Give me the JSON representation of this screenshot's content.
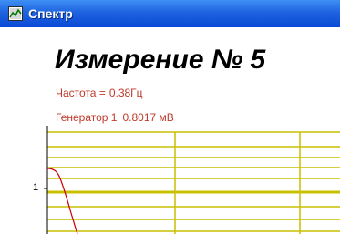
{
  "window": {
    "title": "Спектр",
    "icon": "chart-window-icon"
  },
  "measurement": {
    "heading": "Измерение № 5",
    "frequency_label": "Частота =",
    "frequency_value": "0.38Гц",
    "generator_label": "Генератор 1",
    "generator_value": "0.8017 мВ"
  },
  "chart_data": {
    "type": "line",
    "y_tick_labels": [
      "1"
    ],
    "grid": true,
    "colors": {
      "grid": "#c8c000",
      "curve": "#cc0000",
      "text": "#c0392b"
    }
  }
}
